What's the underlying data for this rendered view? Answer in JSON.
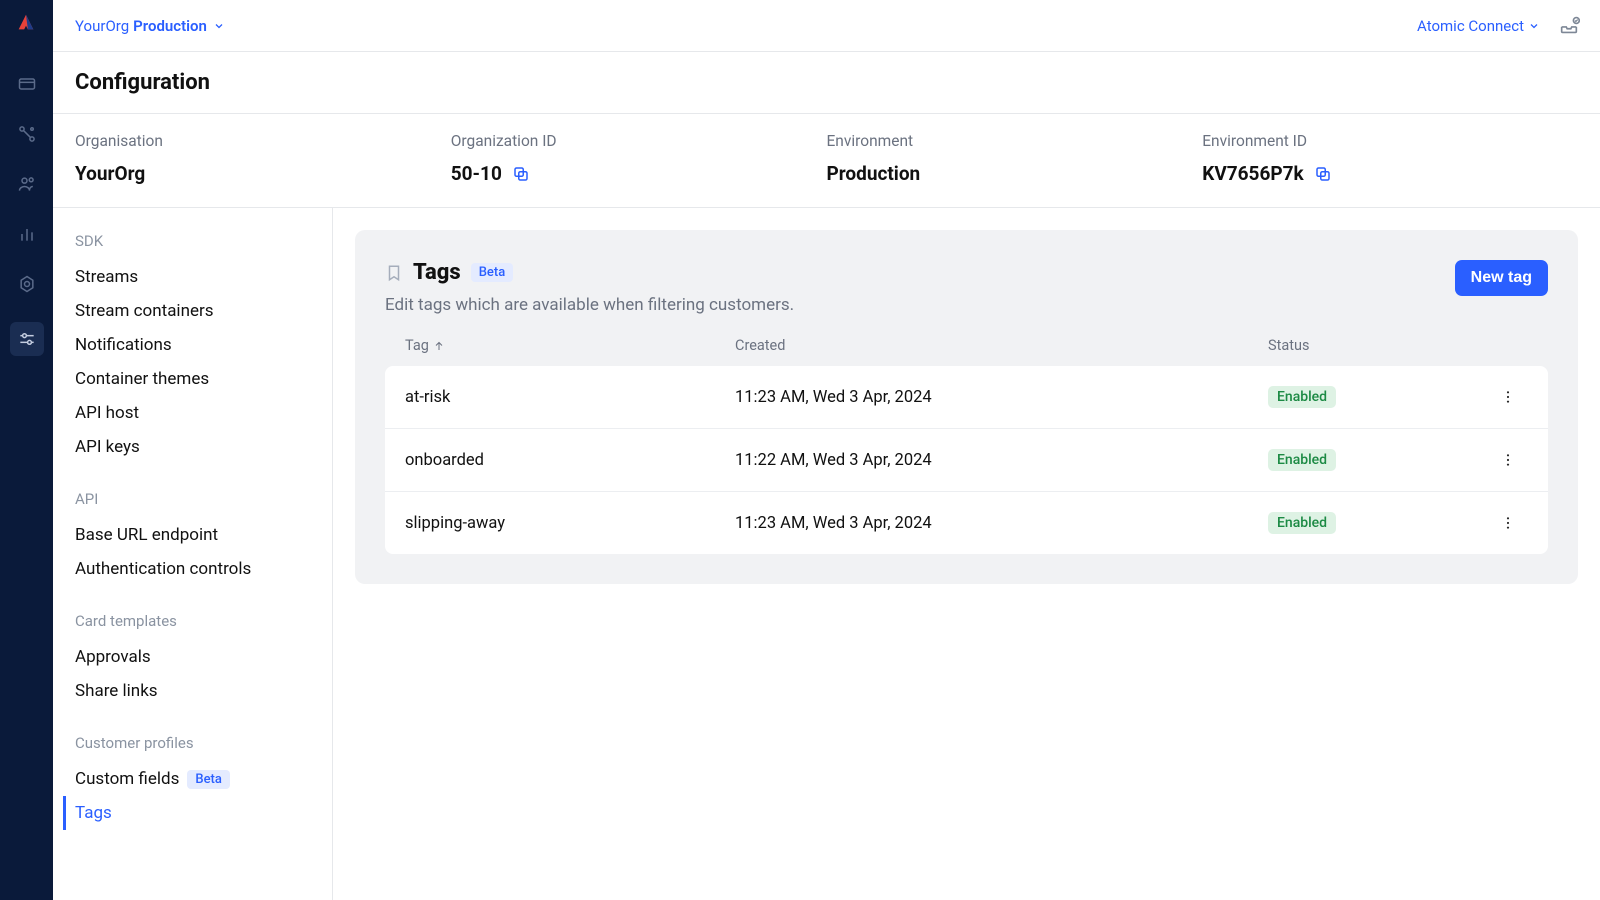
{
  "topbar": {
    "org": "YourOrg",
    "env": "Production",
    "connect_label": "Atomic Connect"
  },
  "page_title": "Configuration",
  "meta": {
    "org_label": "Organisation",
    "org_value": "YourOrg",
    "orgid_label": "Organization ID",
    "orgid_value": "50-10",
    "env_label": "Environment",
    "env_value": "Production",
    "envid_label": "Environment ID",
    "envid_value": "KV7656P7k"
  },
  "sidebar": {
    "sections": [
      {
        "label": "SDK",
        "items": [
          {
            "label": "Streams"
          },
          {
            "label": "Stream containers"
          },
          {
            "label": "Notifications"
          },
          {
            "label": "Container themes"
          },
          {
            "label": "API host"
          },
          {
            "label": "API keys"
          }
        ]
      },
      {
        "label": "API",
        "items": [
          {
            "label": "Base URL endpoint"
          },
          {
            "label": "Authentication controls"
          }
        ]
      },
      {
        "label": "Card templates",
        "items": [
          {
            "label": "Approvals"
          },
          {
            "label": "Share links"
          }
        ]
      },
      {
        "label": "Customer profiles",
        "items": [
          {
            "label": "Custom fields",
            "beta": true
          },
          {
            "label": "Tags",
            "active": true
          }
        ]
      }
    ]
  },
  "panel": {
    "title": "Tags",
    "beta_label": "Beta",
    "subtitle": "Edit tags which are available when filtering customers.",
    "new_button": "New tag"
  },
  "table": {
    "headers": {
      "tag": "Tag",
      "created": "Created",
      "status": "Status"
    },
    "rows": [
      {
        "tag": "at-risk",
        "created": "11:23 AM, Wed 3 Apr, 2024",
        "status": "Enabled"
      },
      {
        "tag": "onboarded",
        "created": "11:22 AM, Wed 3 Apr, 2024",
        "status": "Enabled"
      },
      {
        "tag": "slipping-away",
        "created": "11:23 AM, Wed 3 Apr, 2024",
        "status": "Enabled"
      }
    ]
  },
  "badges": {
    "beta": "Beta"
  }
}
